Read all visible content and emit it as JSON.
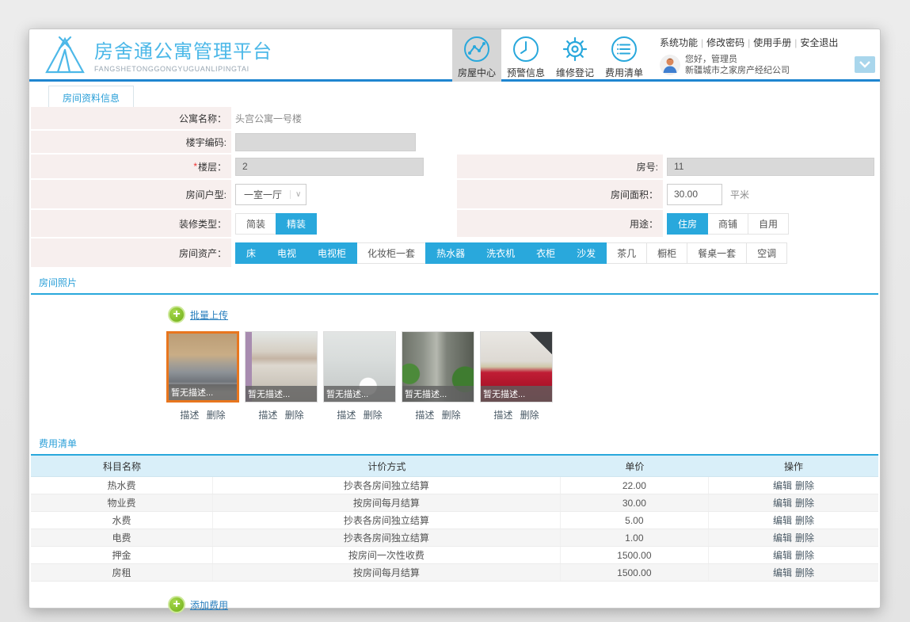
{
  "colors": {
    "accent": "#29a8dc",
    "header_line": "#1f86d0",
    "form_label_bg": "#f7efee",
    "disabled_input": "#d9d9d9",
    "table_head_bg": "#d9eff9",
    "selected_photo_border": "#e8761e",
    "add_icon_green": "#6fae17",
    "logo_cyan": "#4cb8e8"
  },
  "header": {
    "logo_title": "房舍通公寓管理平台",
    "logo_subtitle": "FANGSHETONGGONGYUGUANLIPINGTAI",
    "nav": [
      {
        "label": "房屋中心",
        "icon": "house-center-chart-icon",
        "active": true
      },
      {
        "label": "预警信息",
        "icon": "clock-alert-icon",
        "active": false
      },
      {
        "label": "维修登记",
        "icon": "gear-repair-icon",
        "active": false
      },
      {
        "label": "费用清单",
        "icon": "list-fees-icon",
        "active": false
      }
    ],
    "links": [
      "系统功能",
      "修改密码",
      "使用手册",
      "安全退出"
    ],
    "user": {
      "greeting": "您好，管理员",
      "company": "新疆城市之家房产经纪公司"
    }
  },
  "tab": {
    "label": "房间资料信息"
  },
  "form": {
    "apartment_name": {
      "label": "公寓名称：",
      "value": "头宫公寓一号楼"
    },
    "building_code": {
      "label": "楼宇编码:",
      "value": ""
    },
    "floor": {
      "required_mark": "*",
      "label": "楼层：",
      "value": "2"
    },
    "room_no": {
      "label": "房号:",
      "value": "11"
    },
    "room_type": {
      "label": "房间户型:",
      "value": "一室一厅"
    },
    "room_area": {
      "label": "房间面积：",
      "value": "30.00",
      "unit": "平米"
    },
    "decoration": {
      "label": "装修类型：",
      "options": [
        {
          "label": "简装",
          "selected": false
        },
        {
          "label": "精装",
          "selected": true
        }
      ]
    },
    "usage": {
      "label": "用途：",
      "options": [
        {
          "label": "住房",
          "selected": true
        },
        {
          "label": "商铺",
          "selected": false
        },
        {
          "label": "自用",
          "selected": false
        }
      ]
    },
    "assets": {
      "label": "房间资产：",
      "options": [
        {
          "label": "床",
          "selected": true
        },
        {
          "label": "电视",
          "selected": true
        },
        {
          "label": "电视柜",
          "selected": true
        },
        {
          "label": "化妆柜一套",
          "selected": false
        },
        {
          "label": "热水器",
          "selected": true
        },
        {
          "label": "洗衣机",
          "selected": true
        },
        {
          "label": "衣柜",
          "selected": true
        },
        {
          "label": "沙发",
          "selected": true
        },
        {
          "label": "茶几",
          "selected": false
        },
        {
          "label": "橱柜",
          "selected": false
        },
        {
          "label": "餐桌一套",
          "selected": false
        },
        {
          "label": "空调",
          "selected": false
        }
      ]
    }
  },
  "photos": {
    "section_title": "房间照片",
    "upload_label": "批量上传",
    "action_describe": "描述",
    "action_delete": "删除",
    "items": [
      {
        "caption": "暂无描述...",
        "scene": "living-room",
        "selected": true
      },
      {
        "caption": "暂无描述...",
        "scene": "empty-room",
        "selected": false
      },
      {
        "caption": "暂无描述...",
        "scene": "bathroom",
        "selected": false
      },
      {
        "caption": "暂无描述...",
        "scene": "hallway",
        "selected": false
      },
      {
        "caption": "暂无描述...",
        "scene": "kitchen",
        "selected": false
      }
    ]
  },
  "fees": {
    "section_title": "费用清单",
    "add_label": "添加费用",
    "action_edit": "编辑",
    "action_delete": "删除",
    "columns": [
      "科目名称",
      "计价方式",
      "单价",
      "操作"
    ],
    "rows": [
      {
        "subject": "热水费",
        "method": "抄表各房间独立结算",
        "price": "22.00"
      },
      {
        "subject": "物业费",
        "method": "按房间每月结算",
        "price": "30.00"
      },
      {
        "subject": "水费",
        "method": "抄表各房间独立结算",
        "price": "5.00"
      },
      {
        "subject": "电费",
        "method": "抄表各房间独立结算",
        "price": "1.00"
      },
      {
        "subject": "押金",
        "method": "按房间一次性收费",
        "price": "1500.00"
      },
      {
        "subject": "房租",
        "method": "按房间每月结算",
        "price": "1500.00"
      }
    ]
  }
}
